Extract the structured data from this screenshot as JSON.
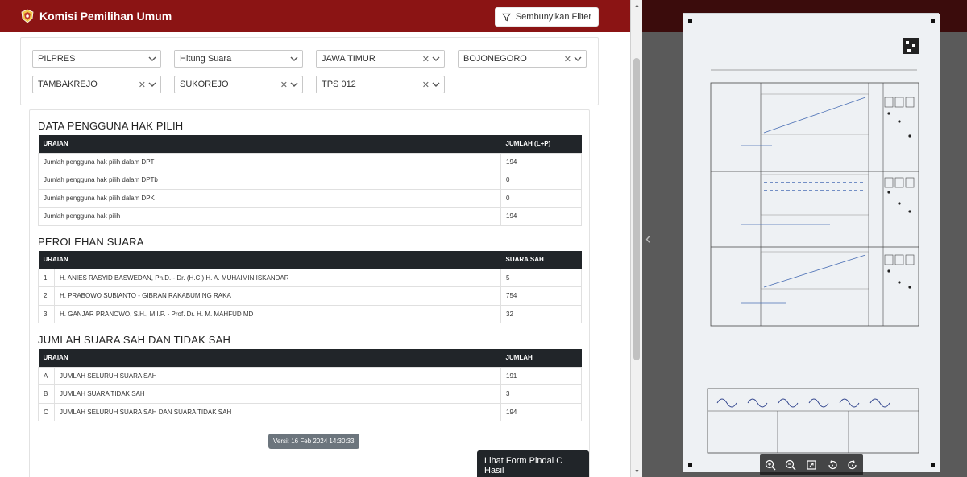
{
  "navbar": {
    "title": "Komisi Pemilihan Umum",
    "filter_button": "Sembunyikan Filter"
  },
  "filters": [
    {
      "value": "PILPRES",
      "clearable": false
    },
    {
      "value": "Hitung Suara",
      "clearable": false
    },
    {
      "value": "JAWA TIMUR",
      "clearable": true
    },
    {
      "value": "BOJONEGORO",
      "clearable": true
    },
    {
      "value": "TAMBAKREJO",
      "clearable": true
    },
    {
      "value": "SUKOREJO",
      "clearable": true
    },
    {
      "value": "TPS 012",
      "clearable": true
    }
  ],
  "pengguna": {
    "title": "DATA PENGGUNA HAK PILIH",
    "col_uraian": "URAIAN",
    "col_jumlah": "JUMLAH (L+P)",
    "rows": [
      {
        "label": "Jumlah pengguna hak pilih dalam DPT",
        "value": "194"
      },
      {
        "label": "Jumlah pengguna hak pilih dalam DPTb",
        "value": "0"
      },
      {
        "label": "Jumlah pengguna hak pilih dalam DPK",
        "value": "0"
      },
      {
        "label": "Jumlah pengguna hak pilih",
        "value": "194"
      }
    ]
  },
  "perolehan": {
    "title": "PEROLEHAN SUARA",
    "col_uraian": "URAIAN",
    "col_suara": "SUARA SAH",
    "rows": [
      {
        "no": "1",
        "label": "H. ANIES RASYID BASWEDAN, Ph.D. - Dr. (H.C.) H. A. MUHAIMIN ISKANDAR",
        "value": "5"
      },
      {
        "no": "2",
        "label": "H. PRABOWO SUBIANTO - GIBRAN RAKABUMING RAKA",
        "value": "754"
      },
      {
        "no": "3",
        "label": "H. GANJAR PRANOWO, S.H., M.I.P. - Prof. Dr. H. M. MAHFUD MD",
        "value": "32"
      }
    ]
  },
  "jumlah": {
    "title": "JUMLAH SUARA SAH DAN TIDAK SAH",
    "col_uraian": "URAIAN",
    "col_jumlah": "JUMLAH",
    "rows": [
      {
        "no": "A",
        "label": "JUMLAH SELURUH SUARA SAH",
        "value": "191"
      },
      {
        "no": "B",
        "label": "JUMLAH SUARA TIDAK SAH",
        "value": "3"
      },
      {
        "no": "C",
        "label": "JUMLAH SELURUH SUARA SAH DAN SUARA TIDAK SAH",
        "value": "194"
      }
    ]
  },
  "version": "Versi: 16 Feb 2024 14:30:33",
  "form_button": "Lihat Form Pindai C Hasil",
  "viewer": {
    "paper_image": "scanned C Hasil form"
  },
  "colors": {
    "navbar": "#8b1414",
    "table_header": "#212529",
    "badge": "#6c757d"
  }
}
